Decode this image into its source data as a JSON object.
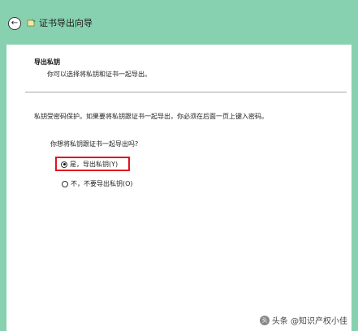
{
  "window": {
    "title": "证书导出向导",
    "back_icon": "back-arrow-icon",
    "frame_color": "#87d1b0"
  },
  "section": {
    "heading": "导出私钥",
    "description": "你可以选择将私钥和证书一起导出。"
  },
  "content": {
    "info": "私钥受密码保护。如果要将私钥跟证书一起导出，你必须在后面一页上键入密码。",
    "question": "你想将私钥跟证书一起导出吗?",
    "options": [
      {
        "label": "是，导出私钥(Y)",
        "selected": true
      },
      {
        "label": "不，不要导出私钥(O)",
        "selected": false
      }
    ],
    "highlight_color": "#e0141f"
  },
  "watermark": {
    "text": "头条 @知识产权小佳"
  }
}
